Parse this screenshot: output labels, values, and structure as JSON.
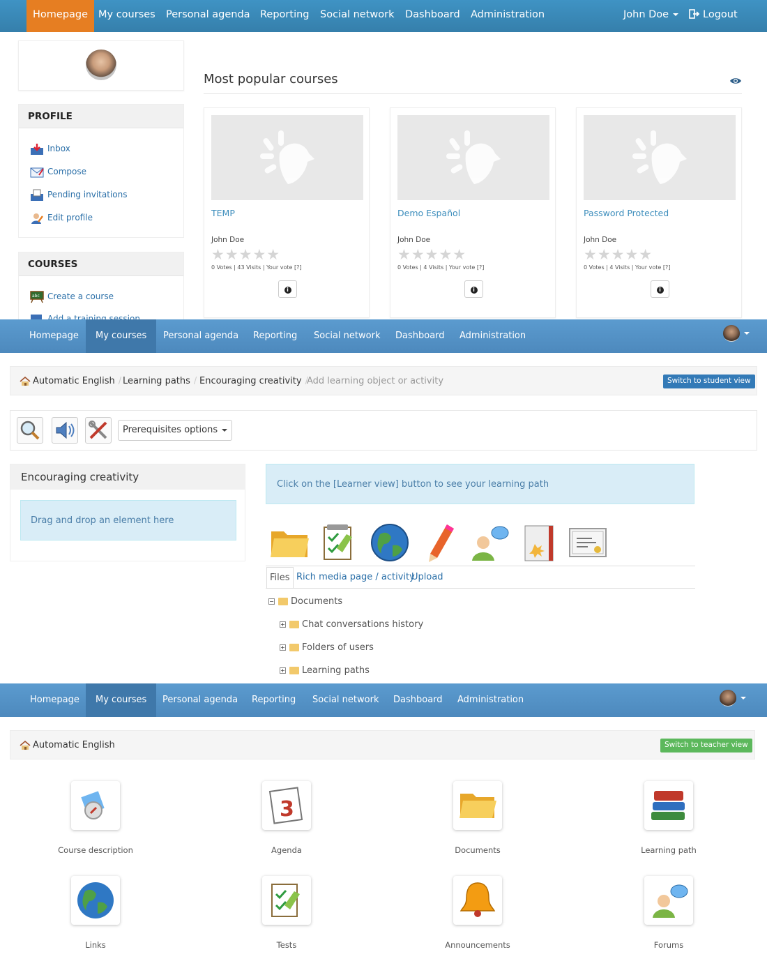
{
  "top_nav": {
    "items": [
      "Homepage",
      "My courses",
      "Personal agenda",
      "Reporting",
      "Social network",
      "Dashboard",
      "Administration"
    ],
    "user": "John Doe",
    "logout": "Logout"
  },
  "profile": {
    "heading": "PROFILE",
    "items": [
      "Inbox",
      "Compose",
      "Pending invitations",
      "Edit profile"
    ]
  },
  "courses_box": {
    "heading": "COURSES",
    "items": [
      "Create a course",
      "Add a training session"
    ]
  },
  "popular": {
    "title": "Most popular courses",
    "cards": [
      {
        "title": "TEMP",
        "teacher": "John Doe",
        "stars": "★★★★★",
        "votes": "0 Votes | 43 Visits | Your vote [?]",
        "info": "i"
      },
      {
        "title": "Demo Español",
        "teacher": "John Doe",
        "stars": "★★★★★",
        "votes": "0 Votes | 4 Visits | Your vote [?]",
        "info": "i"
      },
      {
        "title": "Password Protected",
        "teacher": "John Doe",
        "stars": "★★★★★",
        "votes": "0 Votes | 4 Visits | Your vote [?]",
        "info": "i"
      }
    ]
  },
  "nav2": {
    "items": [
      "Homepage",
      "My courses",
      "Personal agenda",
      "Reporting",
      "Social network",
      "Dashboard",
      "Administration"
    ]
  },
  "lp_breadcrumb": [
    "Automatic English",
    "Learning paths",
    "Encouraging creativity",
    "Add learning object or activity"
  ],
  "switch_student": "Switch to student view",
  "prereq": "Prerequisites options",
  "lp": {
    "title": "Encouraging creativity",
    "drag": "Drag and drop an element here",
    "info": "Click on the [Learner view] button to see your learning path",
    "tabs": [
      "Files",
      "Rich media page / activity",
      "Upload"
    ],
    "tree": [
      {
        "sign": "−",
        "label": "Documents"
      },
      {
        "sign": "+",
        "label": "Chat conversations history"
      },
      {
        "sign": "+",
        "label": "Folders of users"
      },
      {
        "sign": "+",
        "label": "Learning paths"
      }
    ]
  },
  "course_breadcrumb": "Automatic English",
  "switch_teacher": "Switch to teacher view",
  "tools": [
    "Course description",
    "Agenda",
    "Documents",
    "Learning path",
    "Links",
    "Tests",
    "Announcements",
    "Forums"
  ],
  "colors": {
    "nav": "#3c8dbc",
    "active": "#e67e22",
    "teacher_btn": "#5cb85c",
    "student_btn": "#337ab7"
  },
  "icons": [
    "eye-icon",
    "inbox-icon",
    "compose-icon",
    "invitations-icon",
    "edit-profile-icon",
    "create-course-icon",
    "add-session-icon",
    "search-icon",
    "audio-icon",
    "tools-icon",
    "folder-icon",
    "quiz-icon",
    "globe-icon",
    "pencil-icon",
    "forum-icon",
    "book-icon",
    "certificate-icon",
    "compass-icon",
    "calendar-icon",
    "books-icon",
    "bell-icon"
  ]
}
